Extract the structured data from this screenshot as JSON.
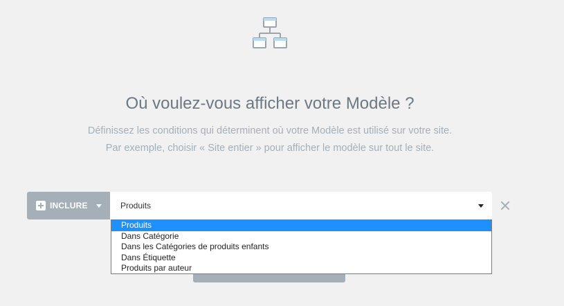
{
  "header": {
    "icon": "sitemap-icon",
    "title": "Où voulez-vous afficher votre Modèle ?",
    "subtitle_line1": "Définissez les conditions qui déterminent où votre Modèle est utilisé sur votre site.",
    "subtitle_line2": "Par exemple, choisir « Site entier » pour afficher le modèle sur tout le site."
  },
  "condition": {
    "include_label": "INCLURE",
    "selected_value": "Produits",
    "options": [
      "Produits",
      "Dans Catégorie",
      "Dans les Catégories de produits enfants",
      "Dans Étiquette",
      "Produits par auteur"
    ],
    "selected_index": 0
  },
  "colors": {
    "background": "#f1f1f1",
    "accent_gray": "#a4afb7",
    "highlight_blue": "#1e90ff"
  }
}
